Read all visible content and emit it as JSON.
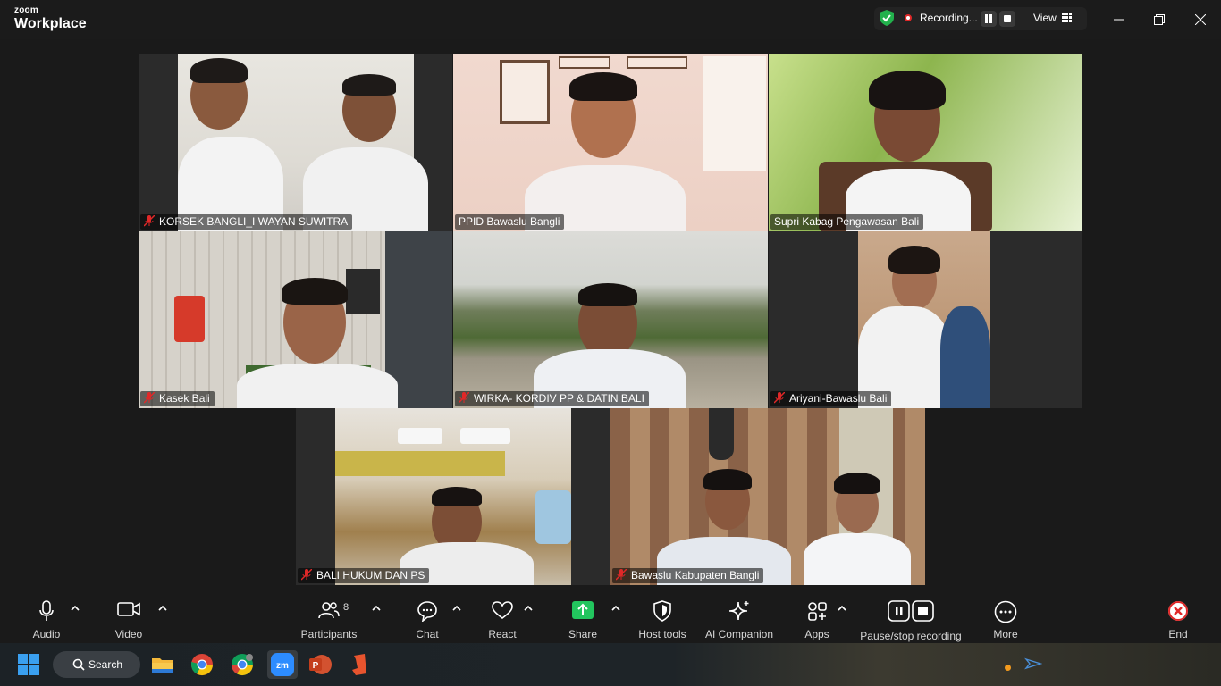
{
  "app": {
    "brand_small": "zoom",
    "brand_big": "Workplace"
  },
  "title_bar": {
    "recording_label": "Recording...",
    "view_label": "View"
  },
  "participants": [
    {
      "name": "KORSEK BANGLI_I WAYAN SUWITRA",
      "muted": true,
      "active_speaker": false
    },
    {
      "name": "PPID Bawaslu Bangli",
      "muted": false,
      "active_speaker": true
    },
    {
      "name": "Supri Kabag Pengawasan Bali",
      "muted": false,
      "active_speaker": false
    },
    {
      "name": "Kasek Bali",
      "muted": true,
      "active_speaker": false
    },
    {
      "name": "WIRKA- KORDIV PP & DATIN BALI",
      "muted": true,
      "active_speaker": false
    },
    {
      "name": "Ariyani-Bawaslu Bali",
      "muted": true,
      "active_speaker": false
    },
    {
      "name": "BALI HUKUM DAN PS",
      "muted": true,
      "active_speaker": false
    },
    {
      "name": "Bawaslu Kabupaten Bangli",
      "muted": true,
      "active_speaker": false
    }
  ],
  "toolbar": {
    "audio": "Audio",
    "video": "Video",
    "participants": "Participants",
    "participants_count": "8",
    "chat": "Chat",
    "react": "React",
    "share": "Share",
    "host_tools": "Host tools",
    "ai_companion": "AI Companion",
    "apps": "Apps",
    "pause_stop_recording": "Pause/stop recording",
    "more": "More",
    "end": "End"
  },
  "taskbar": {
    "search_label": "Search"
  },
  "colors": {
    "active_speaker_border": "#2ad38b",
    "share_green": "#22c55e",
    "end_red": "#e02828",
    "mute_red": "#e02828",
    "shield_green": "#22b14c"
  }
}
